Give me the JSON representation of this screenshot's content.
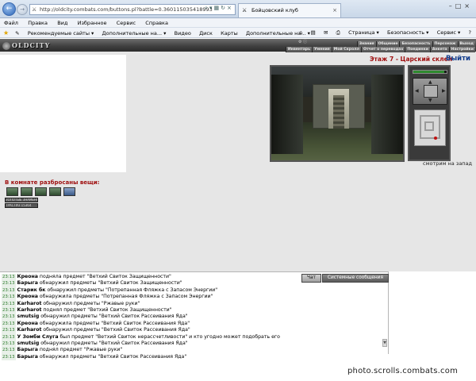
{
  "browser": {
    "address": "http://oldcity.combats.com/buttons.pl?battle=0.360115035418993",
    "tab_title": "Бойцовский клуб",
    "menu": [
      "Файл",
      "Правка",
      "Вид",
      "Избранное",
      "Сервис",
      "Справка"
    ],
    "favorites": {
      "recommended": "Рекомендуемые сайты ▾",
      "addons1": "Дополнительные на... ▾",
      "video": "Видео",
      "disk": "Диск",
      "maps": "Карты",
      "addons2": "Дополнительные на... ▾"
    },
    "tools": {
      "page": "Страница ▾",
      "security": "Безопасность ▾",
      "service": "Сервис ▾",
      "help": "?"
    }
  },
  "game": {
    "logo": "OLDCITY",
    "nav_row1": [
      "Знания",
      "Общение",
      "Безопасность",
      "Персонаж",
      "Выход"
    ],
    "nav_row2": [
      "Инвентарь",
      "Умения",
      "Мой Скролл",
      "Отчет о переводах",
      "Поединки",
      "Анкета",
      "Настройки"
    ],
    "room_title": "Этаж 7 - Царский склеп",
    "exit_label": "Выйти",
    "look_direction": "смотрим на запад",
    "hp_fill": 0.92,
    "items_heading": "В комнате разбросаны вещи:",
    "items_count_icons": [
      "item",
      "item",
      "item",
      "item",
      "item-blue"
    ],
    "badges": [
      "ЗОЛОТЫЕ ЗНАМЕНА",
      "ТРАСТИЗ 15364"
    ]
  },
  "chat": {
    "tabs": [
      "Чат",
      "Системные сообщения"
    ],
    "lines": [
      {
        "time": "23:13",
        "name": "Креона",
        "text": "подняла предмет \"Ветхий Свиток Защищенности\""
      },
      {
        "time": "23:13",
        "name": "Барыга",
        "text": "обнаружил предметы \"Ветхий Свиток Защищенности\""
      },
      {
        "time": "23:13",
        "name": "Старик бк",
        "text": "обнаружил предметы \"Потрепанная Фляжка с Запасом Энергии\""
      },
      {
        "time": "23:13",
        "name": "Креона",
        "text": "обнаружила предметы \"Потрепанная Фляжка с Запасом Энергии\""
      },
      {
        "time": "23:13",
        "name": "Karharot",
        "text": "обнаружил предметы \"Ржавые руки\""
      },
      {
        "time": "23:13",
        "name": "Karharot",
        "text": "поднял предмет \"Ветхий Свиток Защищенности\""
      },
      {
        "time": "23:13",
        "name": "smutsig",
        "text": "обнаружил предметы \"Ветхий Свиток Рассеивания Яда\""
      },
      {
        "time": "23:13",
        "name": "Креона",
        "text": "обнаружила предметы \"Ветхий Свиток Рассеивания Яда\""
      },
      {
        "time": "23:13",
        "name": "Karharot",
        "text": "обнаружил предметы \"Ветхий Свиток Рассеивания Яда\""
      },
      {
        "time": "23:13",
        "name": "У Зомби Слуга",
        "text": "был предмет \"Ветхий Свиток нерассчетливости\" и кто угодно может подобрать его"
      },
      {
        "time": "23:13",
        "name": "smutsig",
        "text": "обнаружил предметы \"Ветхий Свиток Рассеивания Яда\""
      },
      {
        "time": "23:13",
        "name": "Барыга",
        "text": "поднял предмет \"Ржавые руки\""
      },
      {
        "time": "23:13",
        "name": "Барыга",
        "text": "обнаружил предметы \"Ветхий Свиток Рассеивания Яда\""
      }
    ]
  },
  "watermark": "photo.scrolls.combats.com"
}
